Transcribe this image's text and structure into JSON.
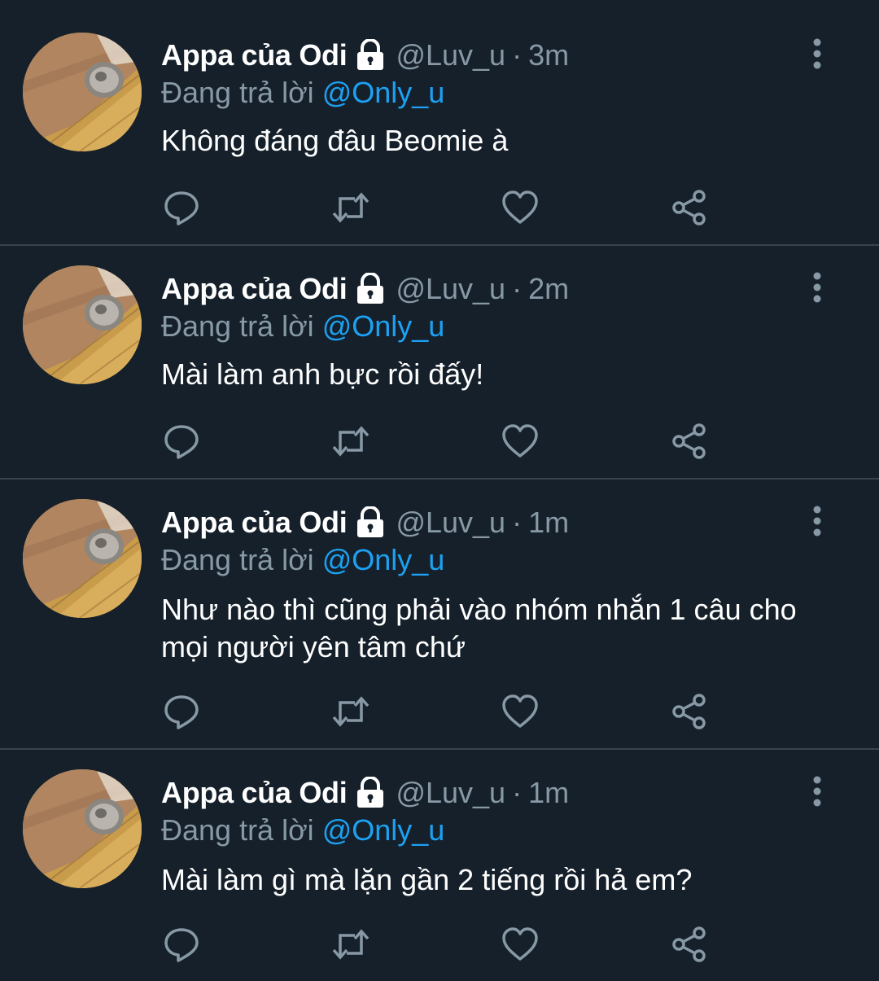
{
  "colors": {
    "background": "#15202b",
    "divider": "#38444d",
    "primary_text": "#ffffff",
    "secondary_text": "#8899a6",
    "mention": "#1da1f2"
  },
  "tweets": [
    {
      "author_name": "Appa của Odi",
      "handle": "@Luv_u",
      "separator": "·",
      "time": "3m",
      "replying_prefix": "Đang trả lời",
      "replying_to": "@Only_u",
      "text": "Không đáng đâu Beomie à",
      "icons": {
        "avatar": "avatar",
        "lock": "lock-icon",
        "more": "more-vertical-icon",
        "reply": "reply-icon",
        "retweet": "retweet-icon",
        "like": "heart-icon",
        "share": "share-icon"
      }
    },
    {
      "author_name": "Appa của Odi",
      "handle": "@Luv_u",
      "separator": "·",
      "time": "2m",
      "replying_prefix": "Đang trả lời",
      "replying_to": "@Only_u",
      "text": "Mài làm anh bực rồi đấy!",
      "icons": {
        "avatar": "avatar",
        "lock": "lock-icon",
        "more": "more-vertical-icon",
        "reply": "reply-icon",
        "retweet": "retweet-icon",
        "like": "heart-icon",
        "share": "share-icon"
      }
    },
    {
      "author_name": "Appa của Odi",
      "handle": "@Luv_u",
      "separator": "·",
      "time": "1m",
      "replying_prefix": "Đang trả lời",
      "replying_to": "@Only_u",
      "text": "Như nào thì cũng phải vào nhóm nhắn 1 câu cho mọi người yên tâm chứ",
      "icons": {
        "avatar": "avatar",
        "lock": "lock-icon",
        "more": "more-vertical-icon",
        "reply": "reply-icon",
        "retweet": "retweet-icon",
        "like": "heart-icon",
        "share": "share-icon"
      }
    },
    {
      "author_name": "Appa của Odi",
      "handle": "@Luv_u",
      "separator": "·",
      "time": "1m",
      "replying_prefix": "Đang trả lời",
      "replying_to": "@Only_u",
      "text": "Mài làm gì mà lặn gần 2 tiếng rồi hả em?",
      "icons": {
        "avatar": "avatar",
        "lock": "lock-icon",
        "more": "more-vertical-icon",
        "reply": "reply-icon",
        "retweet": "retweet-icon",
        "like": "heart-icon",
        "share": "share-icon"
      }
    }
  ]
}
